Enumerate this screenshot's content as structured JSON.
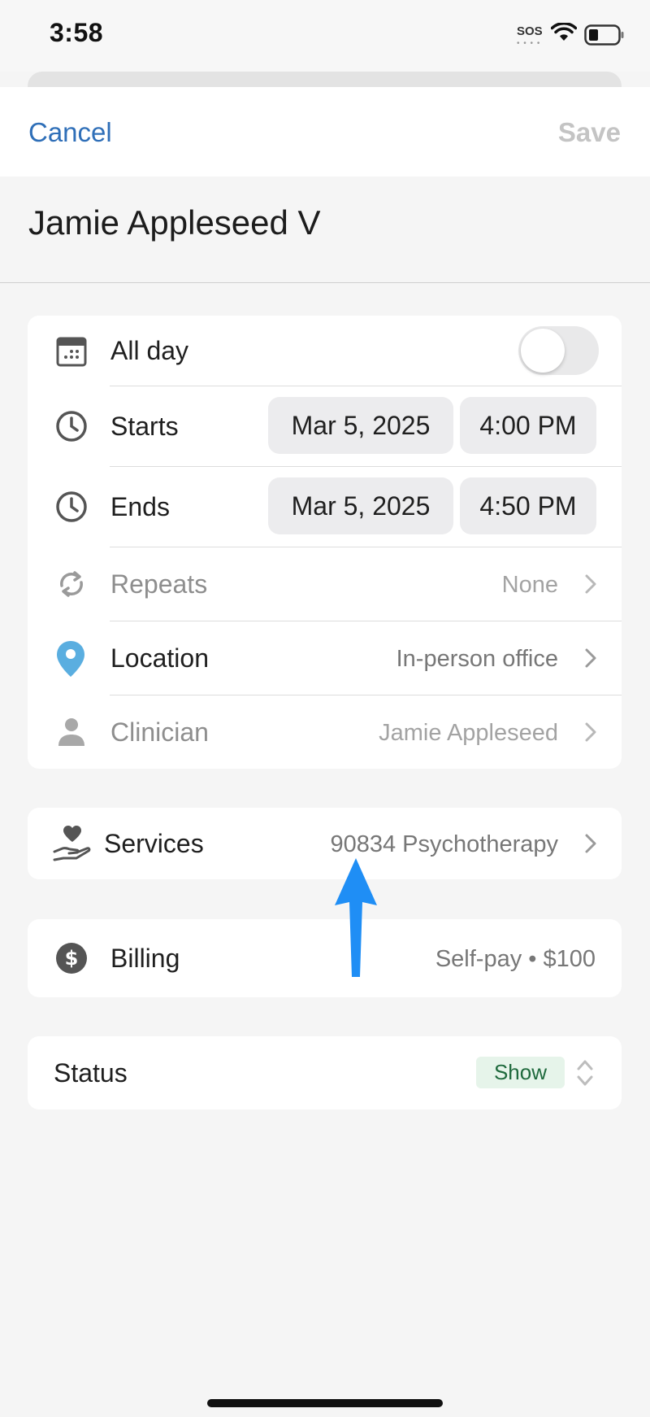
{
  "status_bar": {
    "time": "3:58",
    "sos": "SOS",
    "sos_dots": "• • • •"
  },
  "header": {
    "cancel_label": "Cancel",
    "save_label": "Save"
  },
  "client": {
    "name": "Jamie Appleseed V"
  },
  "event": {
    "all_day_label": "All day",
    "all_day_on": false,
    "starts_label": "Starts",
    "starts_date": "Mar 5, 2025",
    "starts_time": "4:00 PM",
    "ends_label": "Ends",
    "ends_date": "Mar 5, 2025",
    "ends_time": "4:50 PM",
    "repeats_label": "Repeats",
    "repeats_value": "None",
    "location_label": "Location",
    "location_value": "In-person office",
    "clinician_label": "Clinician",
    "clinician_value": "Jamie Appleseed"
  },
  "services": {
    "label": "Services",
    "value": "90834 Psychotherapy"
  },
  "billing": {
    "label": "Billing",
    "value": "Self-pay • $100"
  },
  "status": {
    "label": "Status",
    "value": "Show"
  },
  "colors": {
    "accent": "#2f6fb8",
    "location_pin": "#5aaee0",
    "status_badge_bg": "#e6f4ea",
    "status_badge_text": "#1f6a3d",
    "annotation_arrow": "#1f8ef5"
  },
  "icons": [
    "calendar-icon",
    "clock-icon",
    "repeat-icon",
    "location-pin-icon",
    "person-icon",
    "hand-heart-icon",
    "dollar-circle-icon",
    "chevron-right-icon",
    "sort-chevrons-icon"
  ]
}
